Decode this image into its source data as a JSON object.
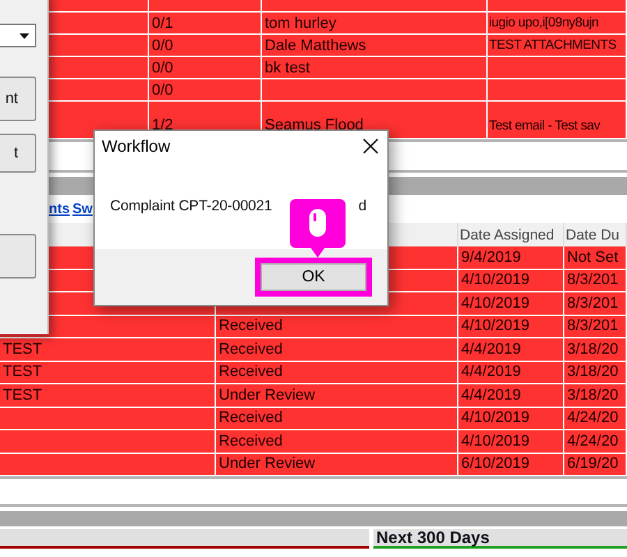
{
  "top_table": {
    "rows": [
      {
        "count": "0/1",
        "name": "tom hurley",
        "note": "iugio upo,i[09ny8ujn"
      },
      {
        "count": "0/0",
        "name": "Dale Matthews",
        "note": "TEST ATTACHMENTS"
      },
      {
        "count": "0/0",
        "name": "bk test"
      },
      {
        "count": "0/0"
      },
      {
        "count": "1/2",
        "name": "Seamus Flood",
        "note": "Test email - Test sav"
      }
    ]
  },
  "links": [
    "nts",
    "Sw"
  ],
  "side_panel": {
    "buttons": [
      "nt",
      "t"
    ]
  },
  "lower_table": {
    "columns": [
      "Date Assigned",
      "Date Du"
    ],
    "rows": [
      {
        "date_assigned": "9/4/2019",
        "date_due": "Not Set"
      },
      {
        "date_assigned": "4/10/2019",
        "date_due": "8/3/201"
      },
      {
        "date_assigned": "4/10/2019",
        "date_due": "8/3/201"
      },
      {
        "status": "Received",
        "date_assigned": "4/10/2019",
        "date_due": "8/3/201"
      },
      {
        "column_1": "TEST",
        "status": "Received",
        "date_assigned": "4/4/2019",
        "date_due": "3/18/20"
      },
      {
        "column_1": "TEST",
        "status": "Received",
        "date_assigned": "4/4/2019",
        "date_due": "3/18/20"
      },
      {
        "column_1": "TEST",
        "status": "Under Review",
        "date_assigned": "4/4/2019",
        "date_due": "3/18/20"
      },
      {
        "status": "Received",
        "date_assigned": "4/10/2019",
        "date_due": "4/24/20"
      },
      {
        "status": "Received",
        "date_assigned": "4/10/2019",
        "date_due": "4/24/20"
      },
      {
        "status": "Under Review",
        "date_assigned": "6/10/2019",
        "date_due": "6/19/20"
      }
    ]
  },
  "summary": {
    "heading": "Next 300 Days"
  },
  "dialog": {
    "title": "Workflow",
    "message": "Complaint CPT-20-00021",
    "message_tail": "d",
    "button": "OK"
  }
}
